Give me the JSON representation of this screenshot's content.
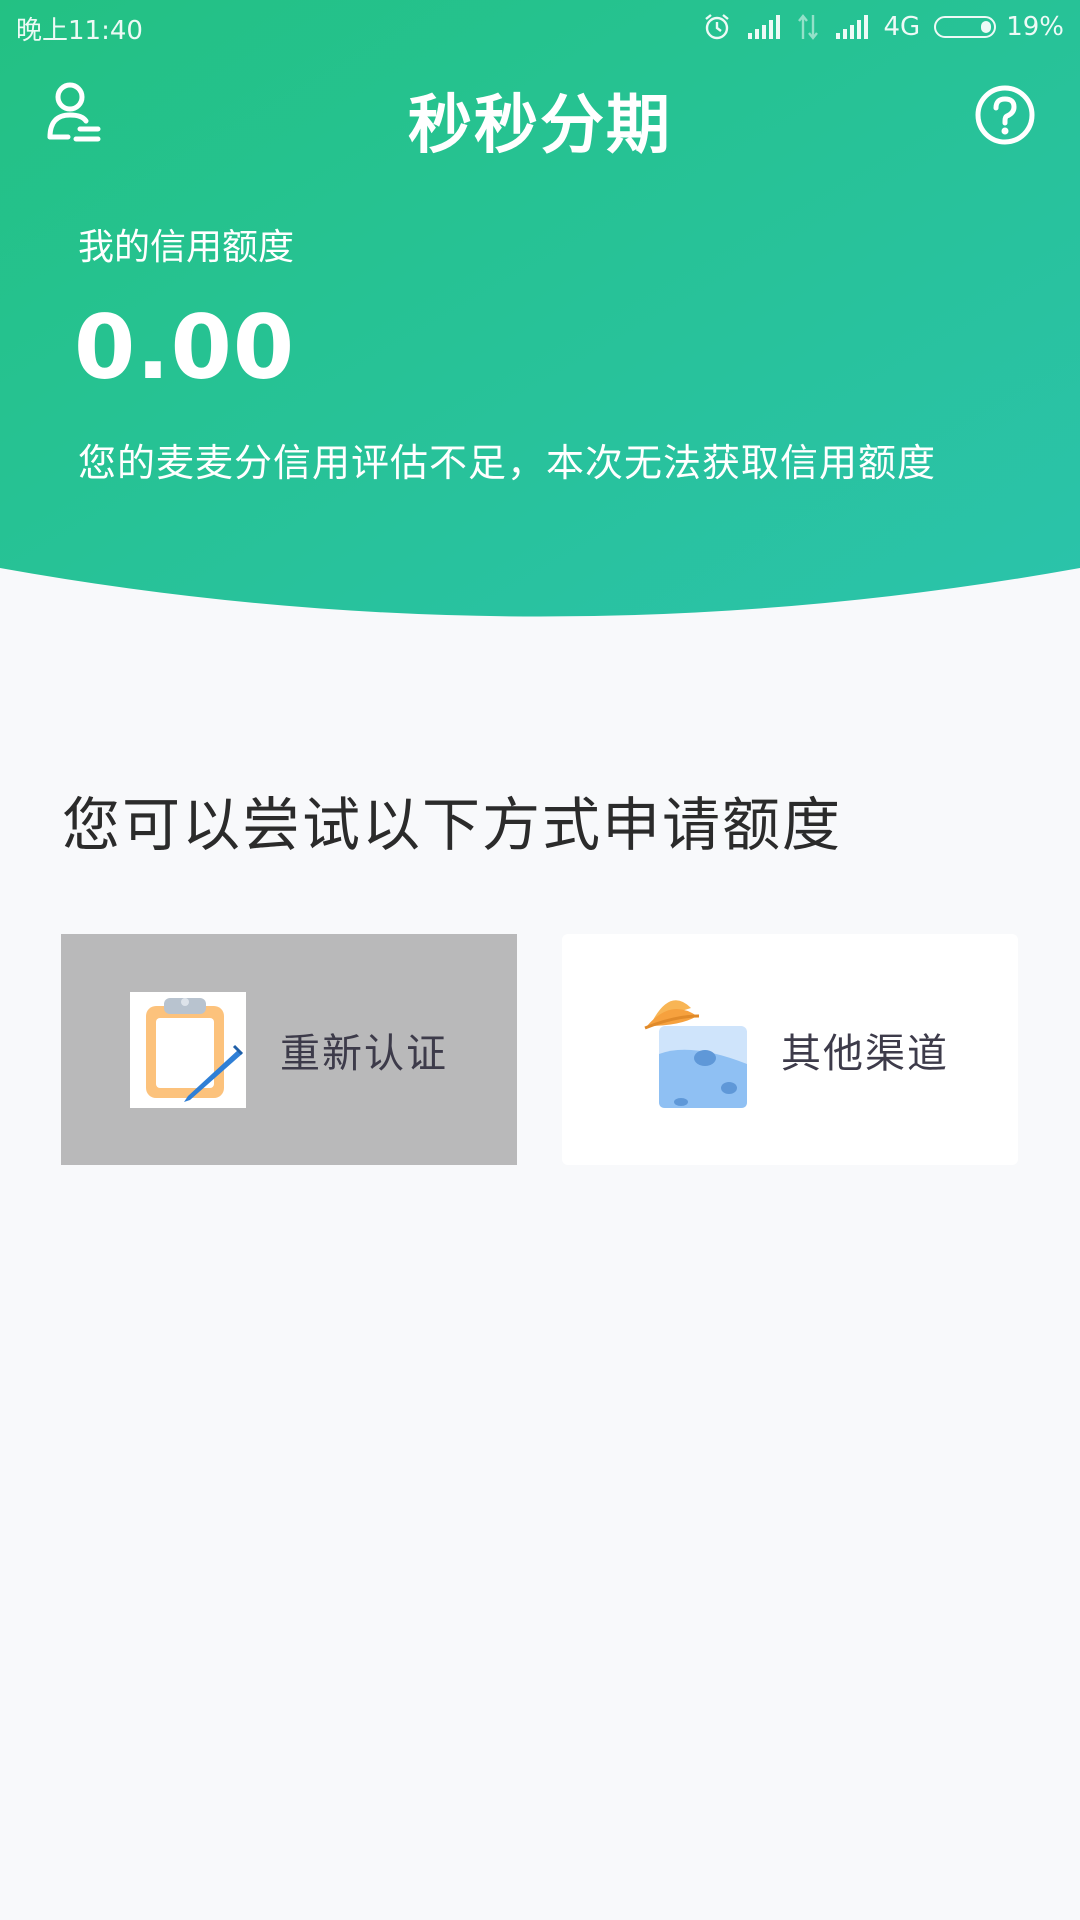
{
  "status_bar": {
    "time": "晚上11:40",
    "network": "4G",
    "battery": "19%",
    "battery_level_percent": 19
  },
  "nav": {
    "title": "秒秒分期",
    "user_icon": "user-icon",
    "help_icon": "help-icon"
  },
  "credit": {
    "label": "我的信用额度",
    "amount": "0.00",
    "notice": "您的麦麦分信用评估不足，本次无法获取信用额度"
  },
  "apply": {
    "title": "您可以尝试以下方式申请额度",
    "options": [
      {
        "label": "重新认证",
        "icon": "clipboard-pencil-icon"
      },
      {
        "label": "其他渠道",
        "icon": "ufo-icon"
      }
    ]
  },
  "colors": {
    "header_gradient_start": "#23c183",
    "header_gradient_end": "#2bc3ab",
    "background": "#f8f9fb",
    "option_pressed": "#b9b9ba",
    "option_default": "#ffffff",
    "text_dark": "#2b2b2b"
  }
}
